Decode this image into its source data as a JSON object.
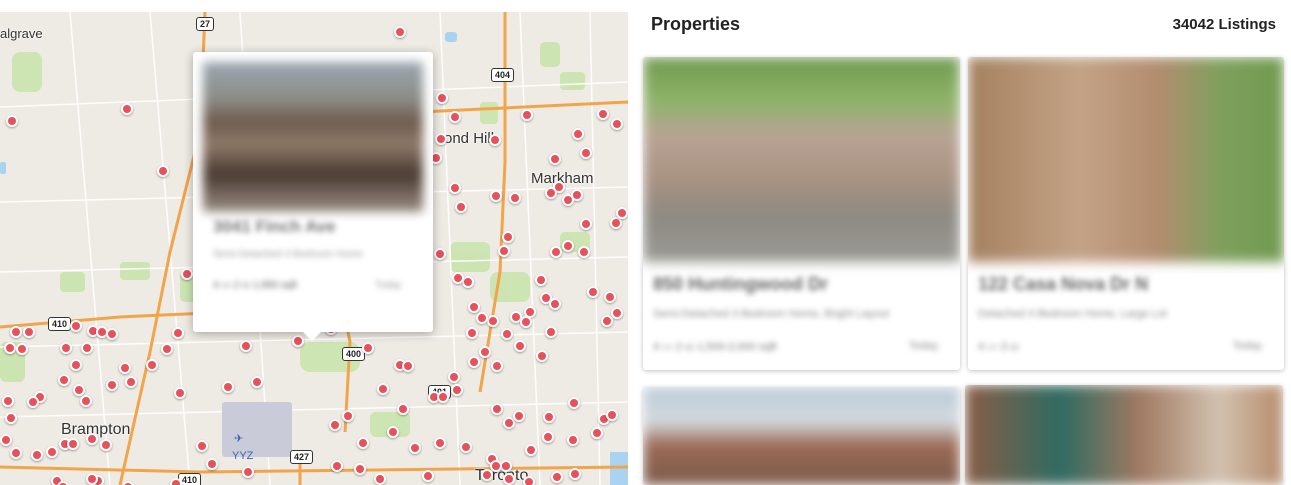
{
  "map": {
    "labels": [
      {
        "text": "algrave",
        "name": "map-label-algrave"
      },
      {
        "text": "ond Hill",
        "name": "map-label-richmond-hill"
      },
      {
        "text": "Markham",
        "name": "map-label-markham"
      },
      {
        "text": "Brampton",
        "name": "map-label-brampton"
      },
      {
        "text": "Toronto",
        "name": "map-label-toronto"
      }
    ],
    "highway_shields": [
      "27",
      "404",
      "410",
      "400",
      "427",
      "410",
      "401"
    ],
    "airport_label": "YYZ",
    "popup": {
      "title": "3041 Finch Ave",
      "subtitle": "Semi-Detached 3 Bedroom Home",
      "meta": "4 ▭ 2 ⛀ 1,950 sqft",
      "time": "Today"
    }
  },
  "header": {
    "title": "Properties",
    "count": "34042 Listings"
  },
  "listings": [
    {
      "address": "850 Huntingwood Dr",
      "description": "Semi-Detached 3 Bedroom Home, Bright Layout",
      "meta": "4 ▭ 2 ⛀ 1,500-2,000 sqft",
      "time": "Today"
    },
    {
      "address": "122 Casa Nova Dr N",
      "description": "Detached 4 Bedroom Home, Large Lot",
      "meta": "4 ▭ 3 ⛀",
      "time": "Today"
    },
    {
      "address": "",
      "description": "",
      "meta": "",
      "time": ""
    },
    {
      "address": "",
      "description": "",
      "meta": "",
      "time": ""
    }
  ],
  "colors": {
    "pin": "#e8505b",
    "map_bg": "#eeebe4",
    "park": "#c6e3a6",
    "highway": "#f2a44b",
    "water": "#a9d3f0"
  }
}
